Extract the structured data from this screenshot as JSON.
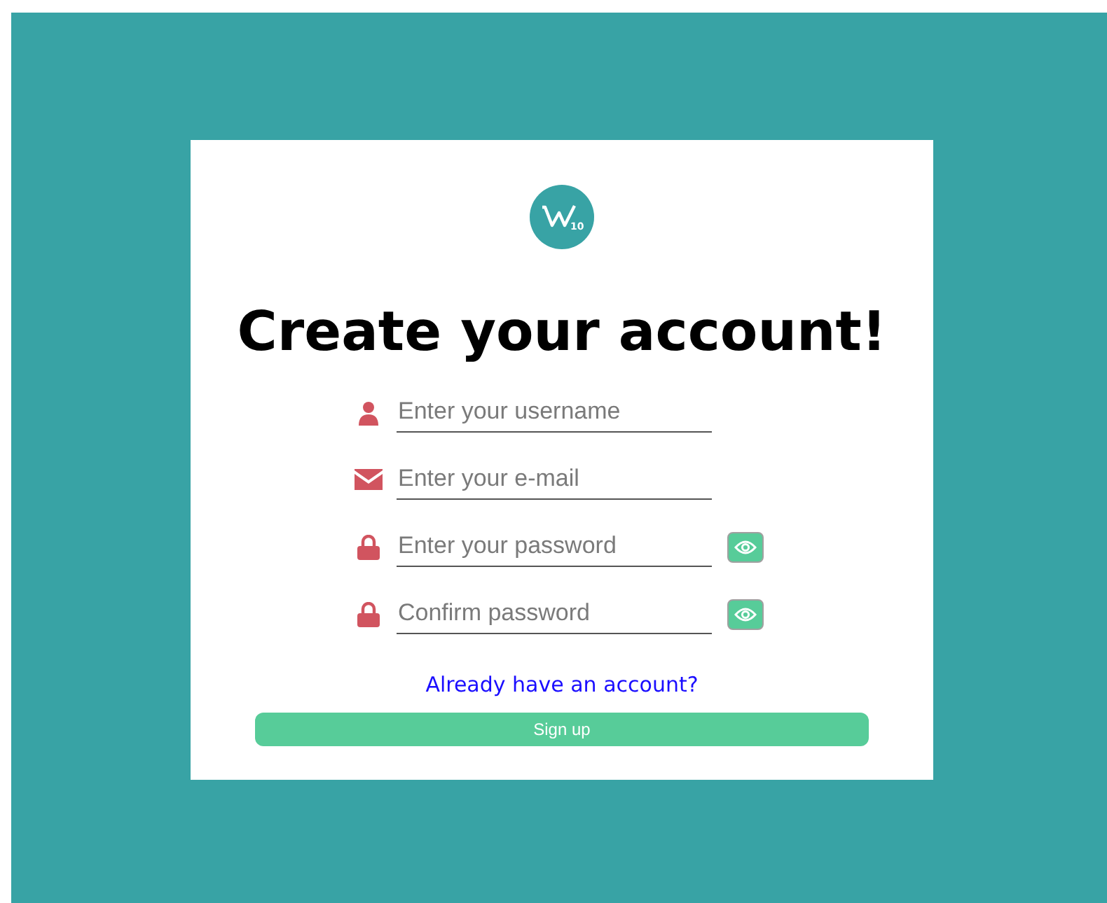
{
  "logo": {
    "badge": "10"
  },
  "title": "Create your account!",
  "fields": [
    {
      "kind": "user",
      "placeholder": "Enter your username",
      "reveal": false
    },
    {
      "kind": "mail",
      "placeholder": "Enter your e-mail",
      "reveal": false
    },
    {
      "kind": "lock",
      "placeholder": "Enter your password",
      "reveal": true
    },
    {
      "kind": "lock",
      "placeholder": "Confirm password",
      "reveal": true
    }
  ],
  "link": "Already have an account?",
  "button": "Sign up"
}
